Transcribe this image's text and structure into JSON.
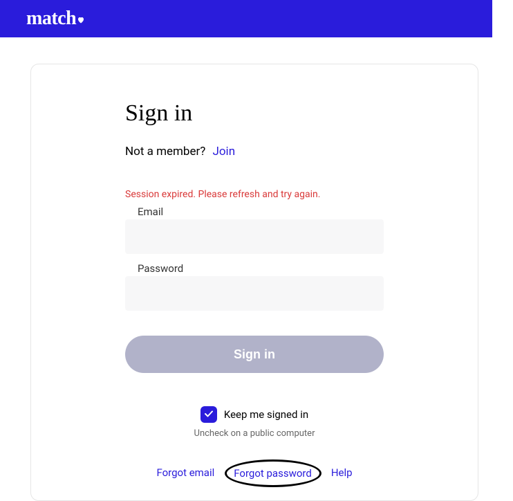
{
  "header": {
    "logo_text": "match"
  },
  "signin": {
    "title": "Sign in",
    "not_member_text": "Not a member?",
    "join_label": "Join",
    "error_message": "Session expired. Please refresh and try again.",
    "email_label": "Email",
    "email_value": "",
    "password_label": "Password",
    "password_value": "",
    "button_label": "Sign in",
    "keep_signed_label": "Keep me signed in",
    "uncheck_note": "Uncheck on a public computer",
    "keep_signed_checked": true
  },
  "links": {
    "forgot_email": "Forgot email",
    "forgot_password": "Forgot password",
    "help": "Help"
  },
  "colors": {
    "brand": "#2a1cdb",
    "error": "#d93838",
    "button_disabled": "#b1b2c9"
  }
}
